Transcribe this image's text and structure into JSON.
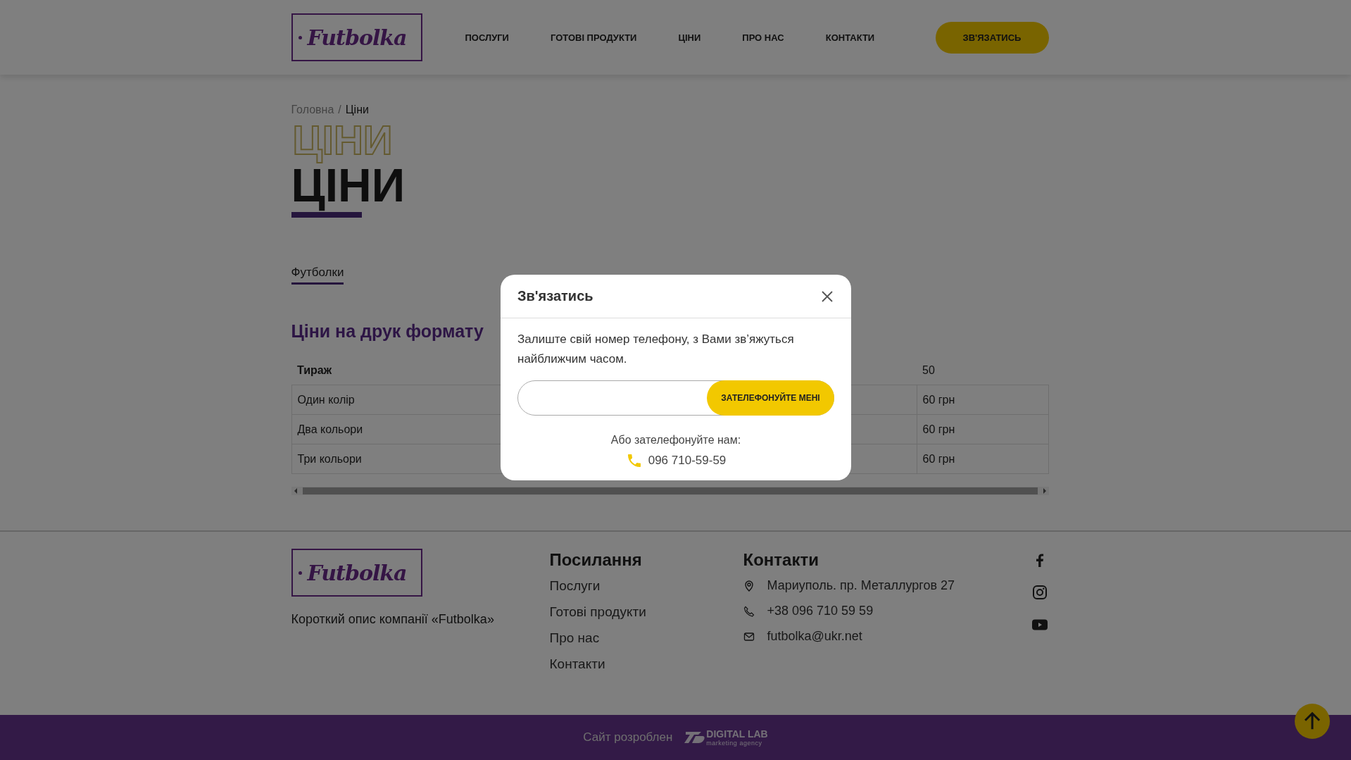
{
  "header": {
    "logo": "Futbolka",
    "nav": [
      {
        "label": "ПОСЛУГИ"
      },
      {
        "label": "ГОТОВІ ПРОДУКТИ"
      },
      {
        "label": "ЦІНИ"
      },
      {
        "label": "ПРО НАС"
      },
      {
        "label": "КОНТАКТИ"
      }
    ],
    "cta": "ЗВ'ЯЗАТИСЬ"
  },
  "breadcrumb": {
    "items": [
      {
        "label": "Головна",
        "kind": "link"
      },
      {
        "label": "Ціни",
        "kind": "current"
      }
    ],
    "separator": "/"
  },
  "page_title": {
    "text": "ЦІНИ",
    "outline": "ЦІНИ"
  },
  "tabs": [
    {
      "label": "Футболки",
      "selected": true
    }
  ],
  "section_heading": "Ціни на друк формату",
  "table": {
    "header": {
      "label": "Тираж",
      "value": "50"
    },
    "rows": [
      {
        "label": "Один колір",
        "value": "60 грн"
      },
      {
        "label": "Два кольори",
        "value": "60 грн"
      },
      {
        "label": "Три кольори",
        "value": "60 грн"
      }
    ]
  },
  "footer": {
    "logo": "Futbolka",
    "description": "Короткий опис компанії «Futbolka»",
    "links_title": "Посилання",
    "links": [
      "Послуги",
      "Готові продукти",
      "Про нас",
      "Контакти"
    ],
    "contacts_title": "Контакти",
    "contacts": [
      {
        "kind": "address",
        "text": "Мариуполь. пр. Металлургов 27"
      },
      {
        "kind": "phone",
        "text": "+38 096 710 59 59"
      },
      {
        "kind": "email",
        "text": "futbolka@ukr.net"
      }
    ],
    "social": [
      {
        "kind": "facebook"
      },
      {
        "kind": "instagram"
      },
      {
        "kind": "youtube"
      }
    ]
  },
  "bottom_bar": {
    "credit": "Сайт розроблен",
    "developer_logo": "DIGITAL LAB",
    "developer_tagline": "marketing agency"
  },
  "modal": {
    "title": "Зв'язатись",
    "text": "Залиште свій номер телефону, з Вами зв’яжуться найближчим часом.",
    "button": "ЗАТЕЛЕФОНУЙТЕ МЕНІ",
    "alt_text": "Або зателефонуйте нам:",
    "phone": "096 710-59-59"
  }
}
